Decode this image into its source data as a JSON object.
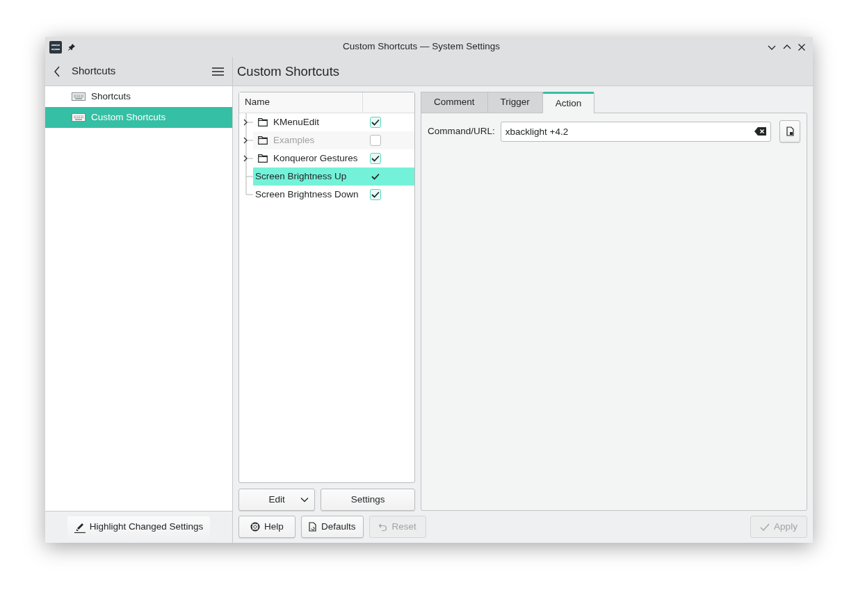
{
  "window": {
    "title": "Custom Shortcuts — System Settings"
  },
  "sidebar": {
    "back_label": "Shortcuts",
    "items": [
      {
        "label": "Shortcuts",
        "selected": false
      },
      {
        "label": "Custom Shortcuts",
        "selected": true
      }
    ],
    "footer_button": "Highlight Changed Settings"
  },
  "page_title": "Custom Shortcuts",
  "tree": {
    "columns": [
      "Name"
    ],
    "rows": [
      {
        "kind": "folder",
        "label": "KMenuEdit",
        "checked": true,
        "disabled": false,
        "selected": false
      },
      {
        "kind": "folder",
        "label": "Examples",
        "checked": false,
        "disabled": true,
        "selected": false
      },
      {
        "kind": "folder",
        "label": "Konqueror Gestures",
        "checked": true,
        "disabled": false,
        "selected": false
      },
      {
        "kind": "action",
        "label": "Screen Brightness Up",
        "checked": true,
        "disabled": false,
        "selected": true
      },
      {
        "kind": "action",
        "label": "Screen Brightness Down",
        "checked": true,
        "disabled": false,
        "selected": false
      }
    ],
    "buttons": [
      {
        "kind": "dropdown",
        "label": "Edit"
      },
      {
        "kind": "plain",
        "label": "Settings"
      }
    ]
  },
  "tabs": [
    {
      "label": "Comment",
      "selected": false
    },
    {
      "label": "Trigger",
      "selected": false
    },
    {
      "label": "Action",
      "selected": true
    }
  ],
  "command": {
    "label": "Command/URL:",
    "value": "xbacklight +4.2"
  },
  "footer_buttons": [
    {
      "kind": "help",
      "label": "Help",
      "disabled": false
    },
    {
      "kind": "defaults",
      "label": "Defaults",
      "disabled": false
    },
    {
      "kind": "reset",
      "label": "Reset",
      "disabled": true
    },
    {
      "kind": "apply",
      "label": "Apply",
      "disabled": true
    }
  ]
}
